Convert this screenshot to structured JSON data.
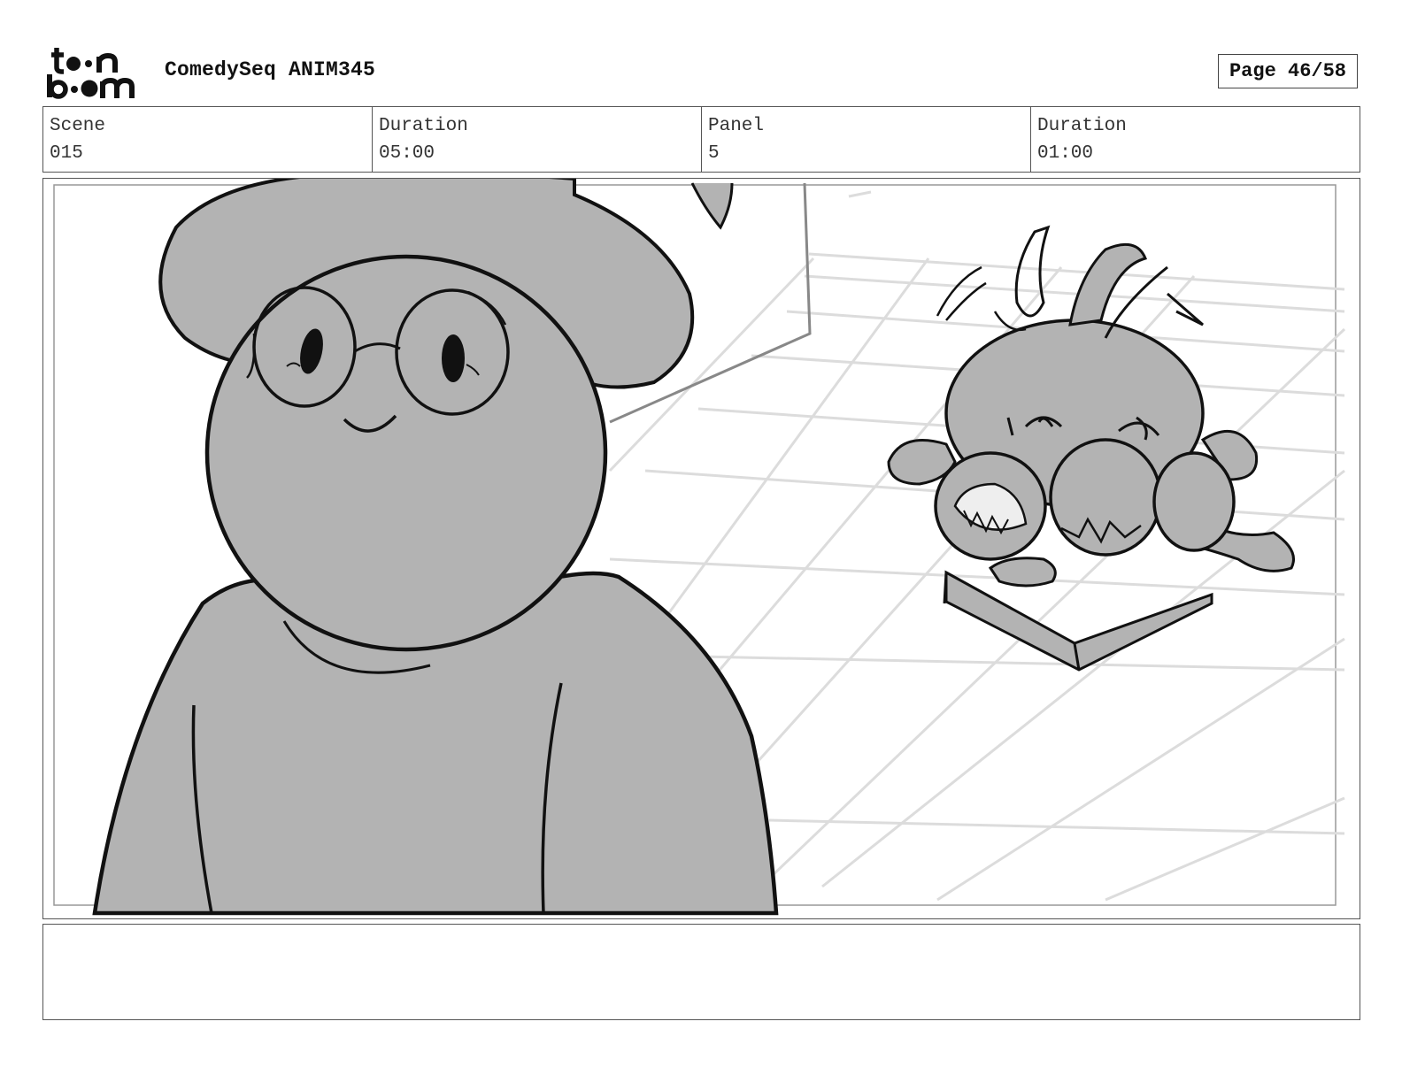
{
  "header": {
    "logo_text": "toon boom",
    "project_title": "ComedySeq ANIM345",
    "page_label": "Page 46/58"
  },
  "info": [
    {
      "label": "Scene",
      "value": "015"
    },
    {
      "label": "Duration",
      "value": "05:00"
    },
    {
      "label": "Panel",
      "value": "5"
    },
    {
      "label": "Duration",
      "value": "01:00"
    }
  ],
  "panel": {
    "drawing": "storyboard sketch: character in wide-brim hat and round glasses, small creature with open mouths lying on a tray, tiled floor",
    "fill_color": "#b3b3b3",
    "line_color": "#111111",
    "grid_color": "#dddddd"
  },
  "notes": {
    "text": ""
  }
}
